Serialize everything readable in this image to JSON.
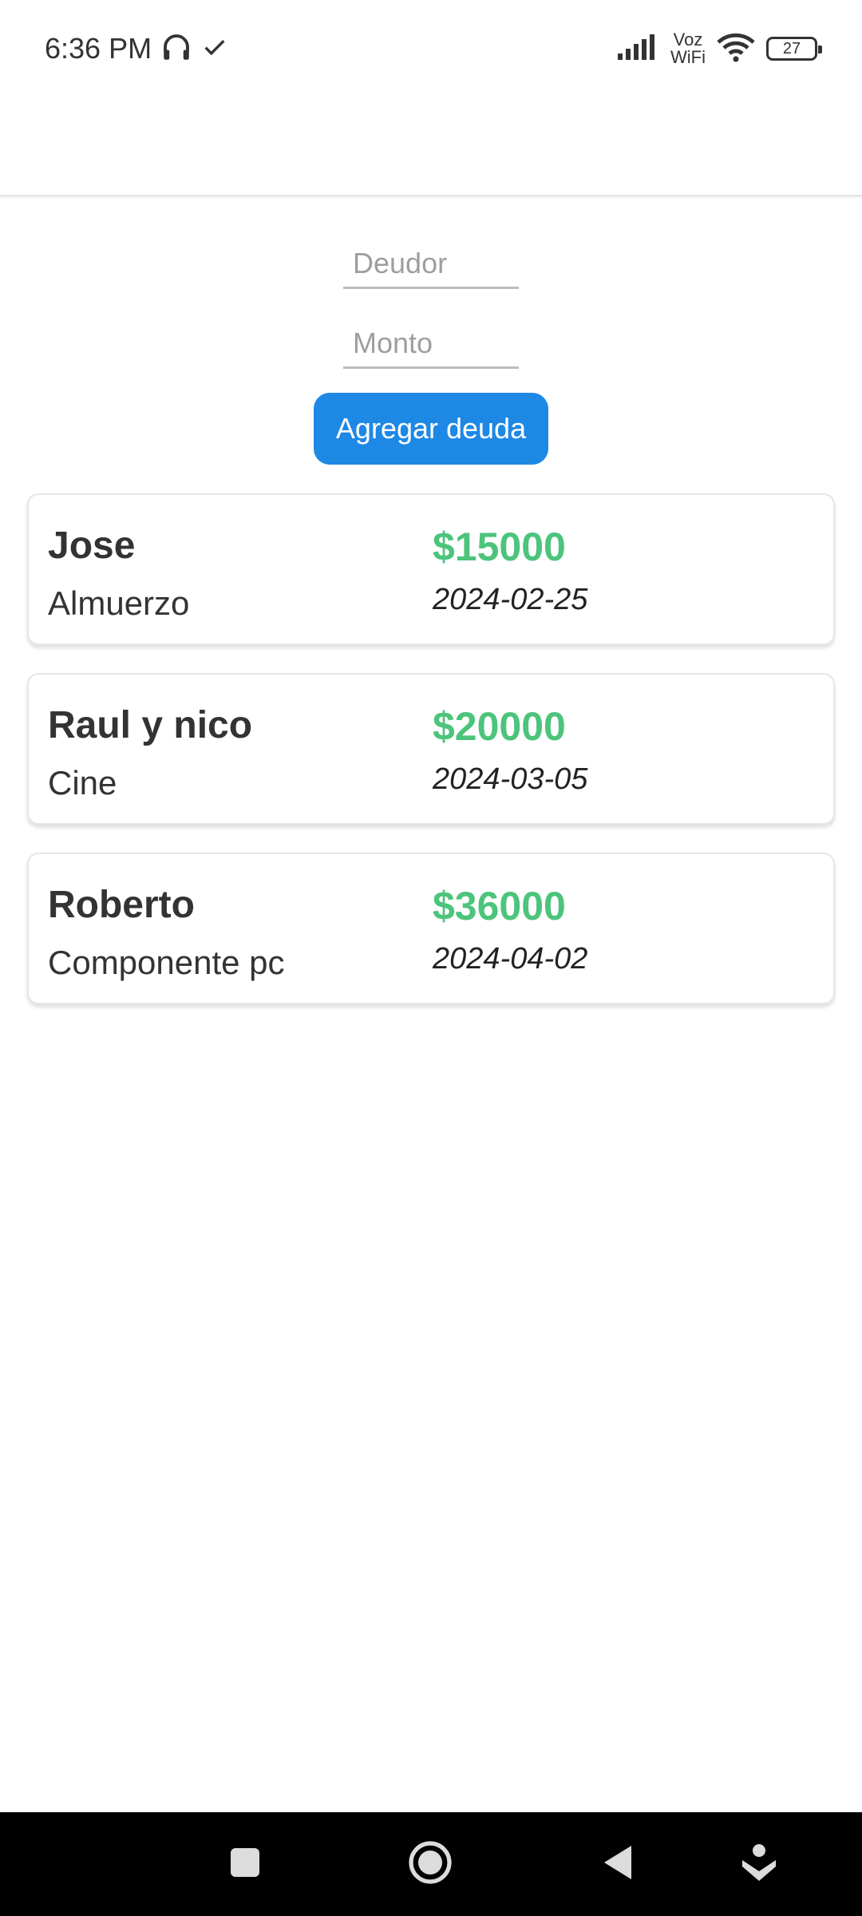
{
  "status_bar": {
    "time": "6:36 PM",
    "voz": "Voz",
    "wifi": "WiFi",
    "battery": "27"
  },
  "form": {
    "debtor_placeholder": "Deudor",
    "amount_placeholder": "Monto",
    "add_button_label": "Agregar deuda",
    "button_color": "#1e88e5"
  },
  "debts": [
    {
      "debtor": "Jose",
      "concept": "Almuerzo",
      "amount": "$15000",
      "date": "2024-02-25"
    },
    {
      "debtor": "Raul y nico",
      "concept": "Cine",
      "amount": "$20000",
      "date": "2024-03-05"
    },
    {
      "debtor": "Roberto",
      "concept": "Componente pc",
      "amount": "$36000",
      "date": "2024-04-02"
    }
  ],
  "colors": {
    "amount": "#4cc47b",
    "nav_background": "#000000"
  },
  "nav": {
    "icons": [
      "recents-square-icon",
      "home-circle-icon",
      "back-triangle-icon",
      "assistant-icon"
    ]
  }
}
